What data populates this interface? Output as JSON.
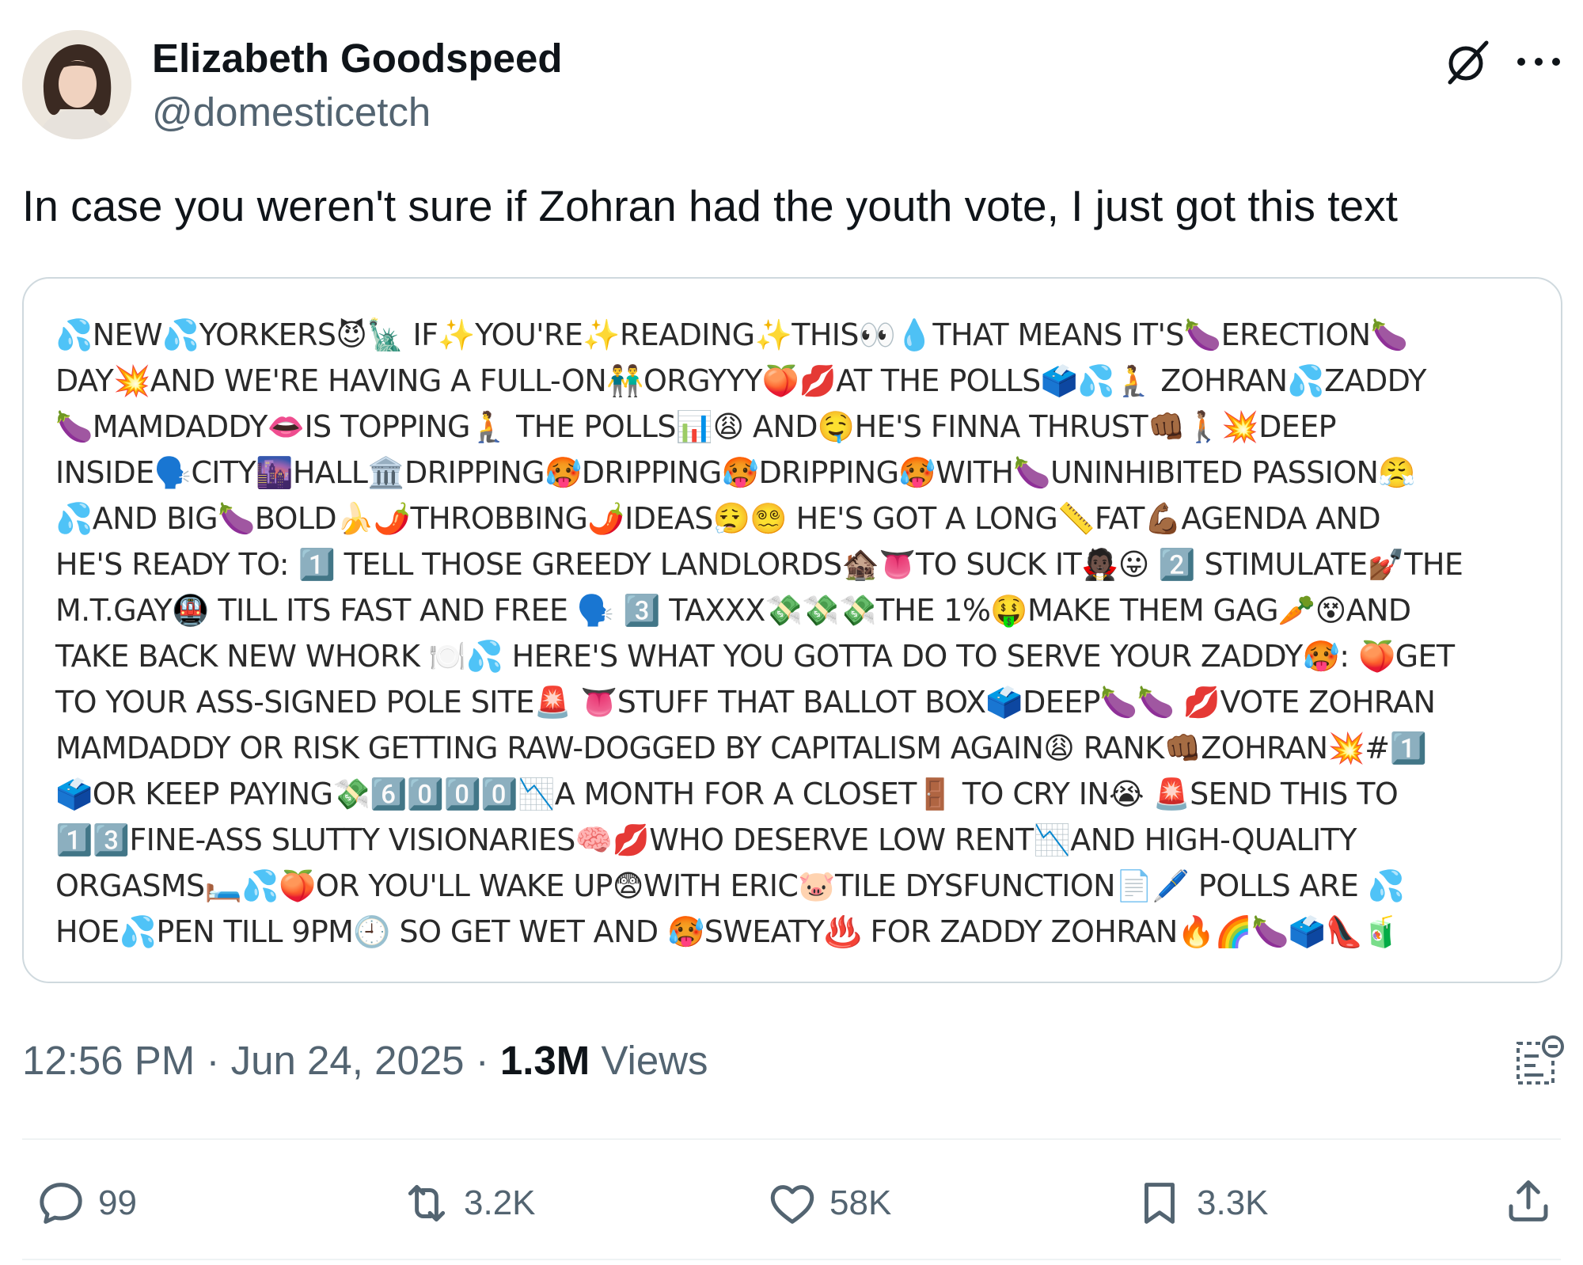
{
  "author": {
    "name": "Elizabeth Goodspeed",
    "handle": "@domesticetch"
  },
  "tweet": {
    "text": "In case you weren't sure if Zohran had the youth vote, I just got this text"
  },
  "embedded_message": {
    "lines": [
      "💦NEW💦YORKERS😈🗽 IF✨YOU'RE✨READING✨THIS👀💧THAT MEANS IT'S🍆ERECTION🍆",
      "DAY💥AND WE'RE HAVING A FULL-ON👬ORGYYY🍑💋AT THE POLLS🗳️💦🧎 ZOHRAN💦ZADDY",
      "🍆MAMDADDY👄IS TOPPING🧎 THE POLLS📊😩 AND🤤HE'S FINNA THRUST👊🏾🚶🏽💥DEEP",
      "INSIDE🗣️CITY🌆HALL🏛️DRIPPING🥵DRIPPING🥵DRIPPING🥵WITH🍆UNINHIBITED PASSION😤",
      "💦AND BIG🍆BOLD🍌🌶️THROBBING🌶️IDEAS😮‍💨😵‍💫 HE'S GOT A LONG📏FAT💪🏾AGENDA AND",
      "HE'S READY TO: 1️⃣ TELL THOSE GREEDY LANDLORDS🏚️👅TO SUCK IT🧛🏿😛 2️⃣ STIMULATE💅🏾THE",
      "M.T.GAY🚇 TILL ITS FAST AND FREE 🗣️ 3️⃣ TAXXX💸💸💸THE 1%🤑MAKE THEM GAG🥕😵AND",
      "TAKE BACK NEW WHORK 🍽️💦 HERE'S WHAT YOU GOTTA DO TO SERVE YOUR ZADDY🥵: 🍑GET",
      "TO YOUR ASS-SIGNED POLE SITE🚨 👅STUFF THAT BALLOT BOX🗳️DEEP🍆🍆 💋VOTE ZOHRAN",
      "MAMDADDY OR RISK GETTING RAW-DOGGED BY CAPITALISM AGAIN😩 RANK👊🏾ZOHRAN💥#1️⃣",
      "🗳️OR KEEP PAYING💸6️⃣0️⃣0️⃣0️⃣📉A MONTH FOR A CLOSET🚪 TO CRY IN😭 🚨SEND THIS TO",
      "1️⃣3️⃣FINE-ASS SLUTTY VISIONARIES🧠💋WHO DESERVE LOW RENT📉AND HIGH-QUALITY",
      "ORGASMS🛏️💦🍑OR YOU'LL WAKE UP😨WITH ERIC🐷TILE DYSFUNCTION📄🖊️ POLLS ARE 💦",
      "HOE💦PEN TILL 9PM🕘 SO GET WET AND 🥵SWEATY♨️ FOR ZADDY ZOHRAN🔥🌈🍆🗳️👠🧃"
    ]
  },
  "meta": {
    "time": "12:56 PM",
    "separator": "·",
    "date": "Jun 24, 2025",
    "views_count": "1.3M",
    "views_label": "Views"
  },
  "actions": {
    "replies": "99",
    "reposts": "3.2K",
    "likes": "58K",
    "bookmarks": "3.3K"
  },
  "icons": {
    "avatar": "avatar-photo",
    "grok": "grok-icon",
    "more": "more-icon",
    "analytics": "analytics-icon",
    "reply": "reply-icon",
    "repost": "repost-icon",
    "like": "heart-icon",
    "bookmark": "bookmark-icon",
    "share": "share-icon"
  },
  "colors": {
    "text_primary": "#0f1419",
    "text_secondary": "#536471",
    "border": "#cfd9de",
    "divider": "#eff3f4"
  }
}
